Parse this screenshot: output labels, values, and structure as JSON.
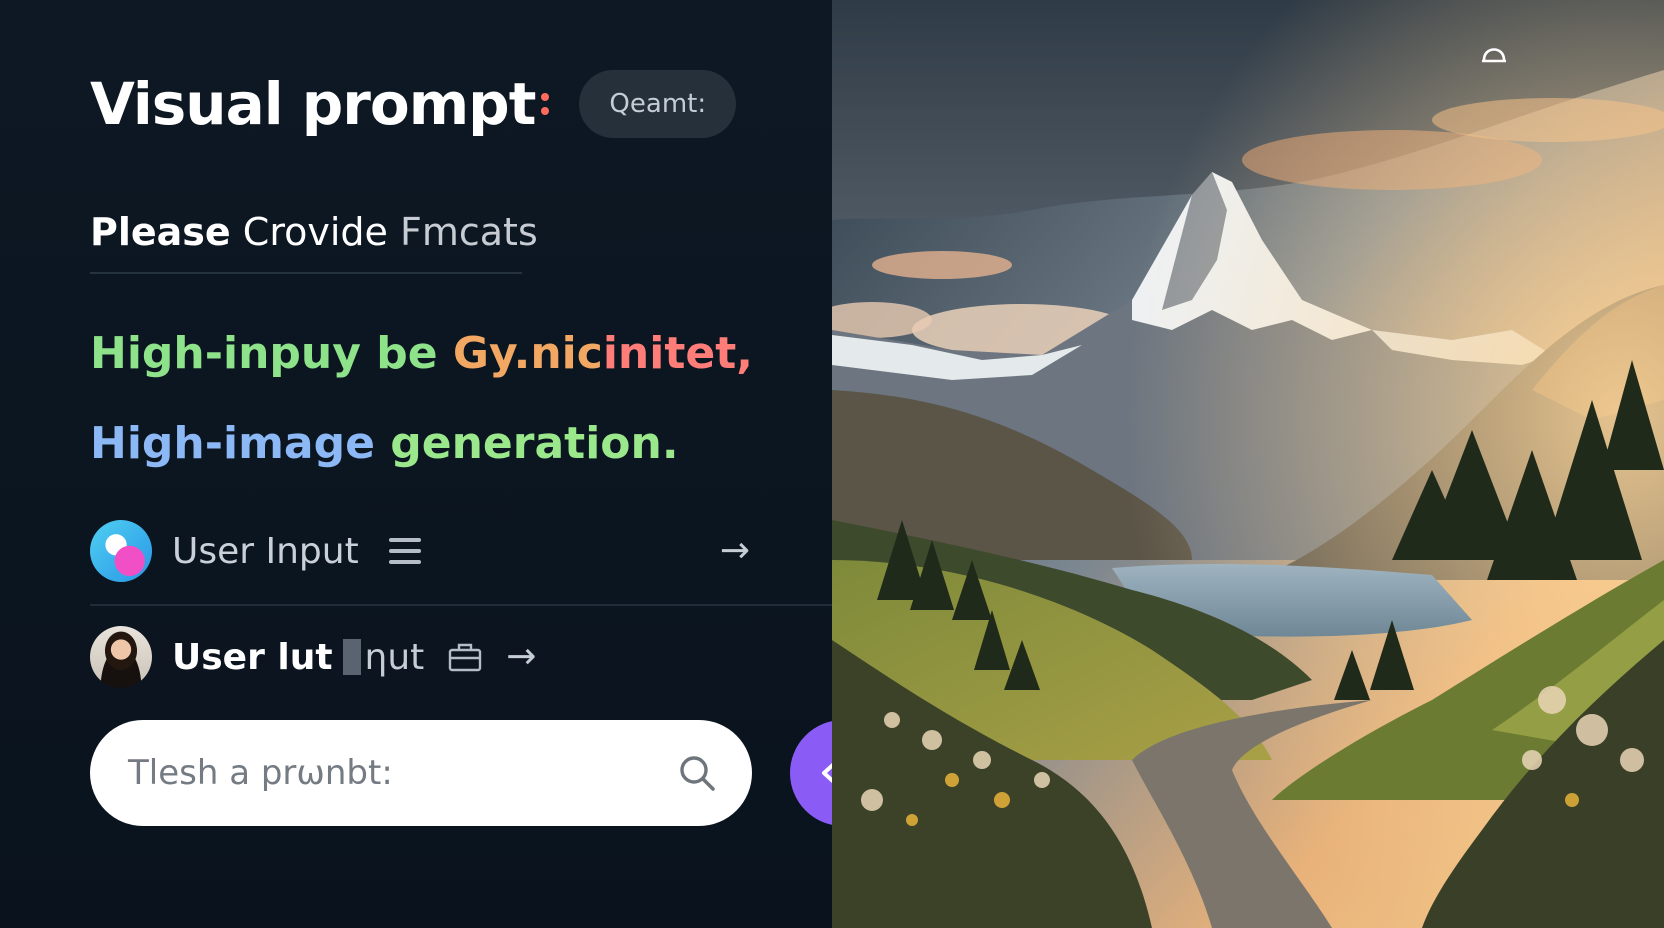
{
  "header": {
    "title": "Visual prompt",
    "pill_label": "Qeamt:"
  },
  "subtitle": {
    "word1": "Please",
    "word2": "Crovide",
    "word3": "Fmcats"
  },
  "headline1": {
    "part1": "High-inpuy be ",
    "part2": "Gy.nic",
    "part3": "initet,"
  },
  "headline2": {
    "part1": "High-image ",
    "part2": "generation."
  },
  "rows": {
    "row1": {
      "label": "User Input",
      "menu_icon": "hamburger-menu-icon",
      "arrow_icon": "arrow-right-icon",
      "arrow": "→"
    },
    "row2": {
      "label_bold": "User lut",
      "label_thin": "ηut",
      "bag_icon": "briefcase-icon",
      "arrow_icon": "arrow-right-icon",
      "arrow": "→"
    }
  },
  "search": {
    "placeholder": "Tlesh a prωnbt:",
    "icon": "search-icon"
  },
  "fab": {
    "icon": "chevron-left-icon",
    "color": "#8a5cf5"
  },
  "image": {
    "subject": "mountain-landscape-image",
    "corner_icon": "dome-icon"
  },
  "colors": {
    "background": "#0b1420",
    "accent_green": "#8de28a",
    "accent_orange": "#f2a862",
    "accent_red": "#ff7d79",
    "accent_blue": "#8cb8f5"
  }
}
